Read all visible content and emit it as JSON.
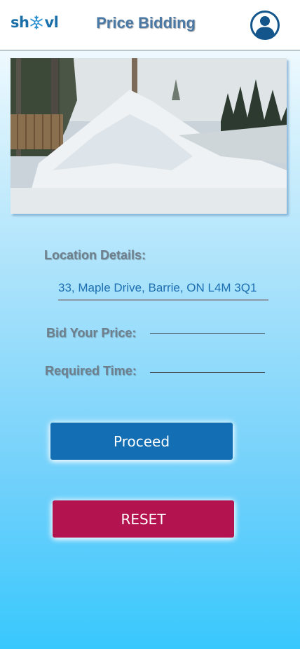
{
  "header": {
    "logo_left": "sh",
    "logo_right": "vl",
    "title": "Price Bidding"
  },
  "form": {
    "location_label": "Location Details:",
    "location_value": "33, Maple Drive, Barrie, ON L4M 3Q1",
    "bid_label": "Bid Your Price:",
    "bid_value": "",
    "time_label": "Required Time:",
    "time_value": ""
  },
  "buttons": {
    "proceed": "Proceed",
    "reset": "RESET"
  },
  "icons": {
    "logo_flake": "snowflake-icon",
    "profile": "user-circle-icon"
  },
  "colors": {
    "proceed": "#146eb4",
    "reset": "#b3134e",
    "title": "#4a79a6"
  }
}
